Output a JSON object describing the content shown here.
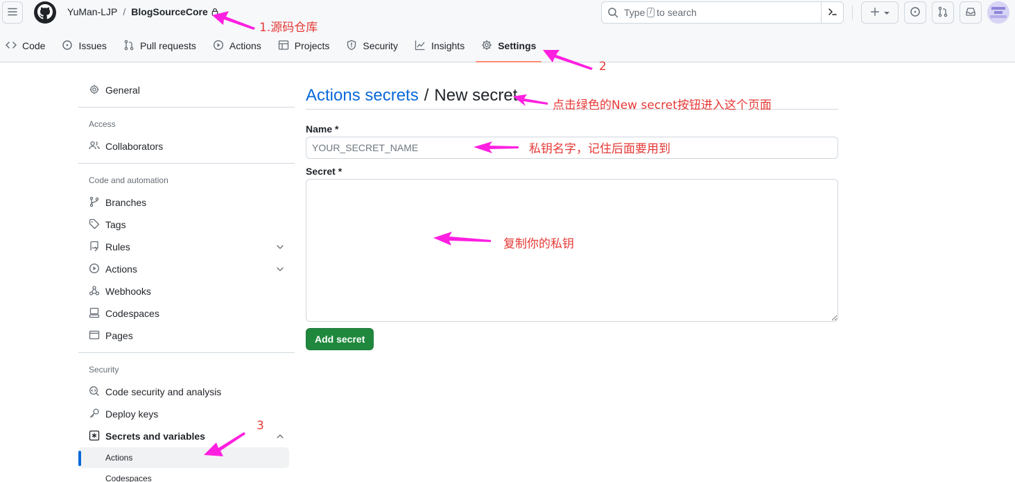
{
  "header": {
    "owner": "YuMan-LJP",
    "separator": "/",
    "repo": "BlogSourceCore",
    "search_placeholder_prefix": "Type",
    "search_key": "/",
    "search_placeholder_suffix": "to search"
  },
  "tabs": [
    {
      "label": "Code",
      "icon": "code-icon"
    },
    {
      "label": "Issues",
      "icon": "issue-icon"
    },
    {
      "label": "Pull requests",
      "icon": "pull-request-icon"
    },
    {
      "label": "Actions",
      "icon": "play-icon"
    },
    {
      "label": "Projects",
      "icon": "table-icon"
    },
    {
      "label": "Security",
      "icon": "shield-icon"
    },
    {
      "label": "Insights",
      "icon": "graph-icon"
    },
    {
      "label": "Settings",
      "icon": "gear-icon",
      "selected": true
    }
  ],
  "sidebar": {
    "general": "General",
    "access_heading": "Access",
    "collaborators": "Collaborators",
    "code_automation_heading": "Code and automation",
    "branches": "Branches",
    "tags": "Tags",
    "rules": "Rules",
    "actions": "Actions",
    "webhooks": "Webhooks",
    "codespaces": "Codespaces",
    "pages": "Pages",
    "security_heading": "Security",
    "code_security": "Code security and analysis",
    "deploy_keys": "Deploy keys",
    "secrets_variables": "Secrets and variables",
    "sub_actions": "Actions",
    "sub_codespaces": "Codespaces"
  },
  "main": {
    "breadcrumb_link": "Actions secrets",
    "breadcrumb_sep": "/",
    "breadcrumb_current": "New secret",
    "name_label": "Name *",
    "name_placeholder": "YOUR_SECRET_NAME",
    "secret_label": "Secret *",
    "secret_value": "",
    "submit_label": "Add secret"
  },
  "annotations": {
    "a1": "1.源码仓库",
    "a2": "2",
    "a3": "3",
    "a4": "点击绿色的New secret按钮进入这个页面",
    "a5": "私钥名字，记住后面要用到",
    "a6": "复制你的私钥",
    "color": "#e53935",
    "arrow_color": "#ff1fe0"
  },
  "colors": {
    "accent": "#0969da",
    "primary_button": "#1f883d",
    "selected_tab_underline": "#fd8c73"
  }
}
